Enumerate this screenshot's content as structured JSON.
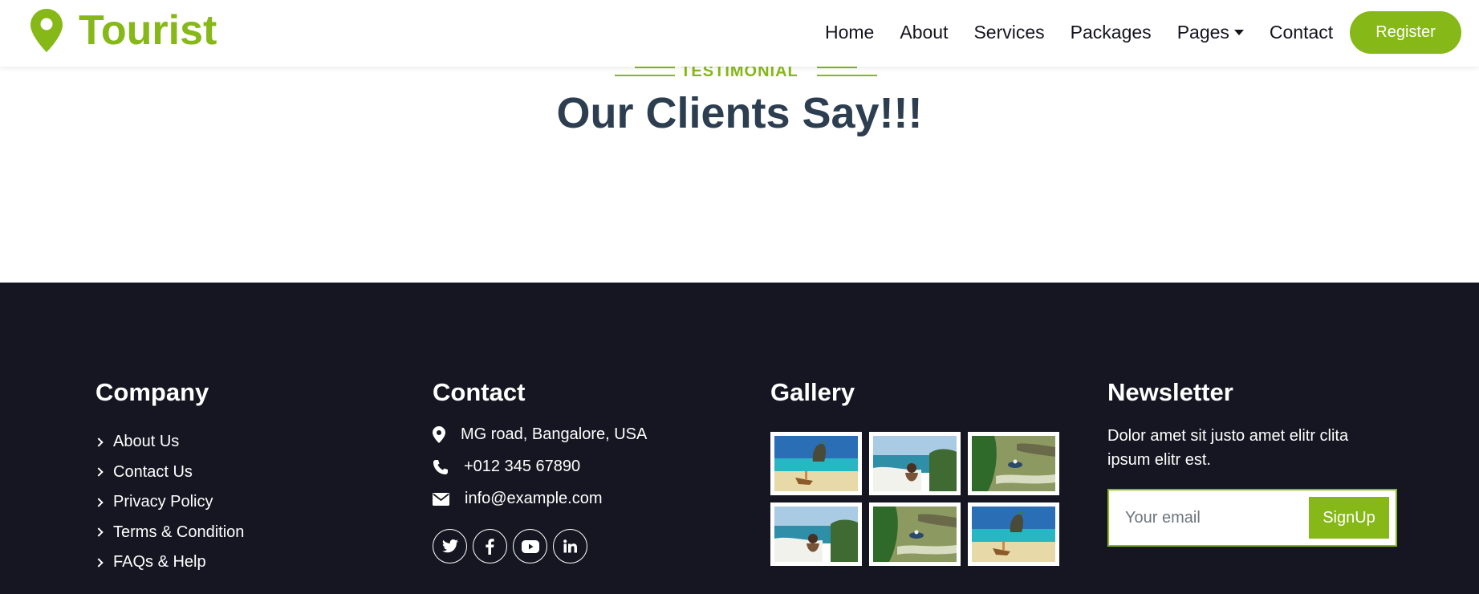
{
  "brand": {
    "name": "Tourist",
    "icon": "map-pin-icon",
    "color": "#86b817"
  },
  "nav": {
    "links": [
      "Home",
      "About",
      "Services",
      "Packages",
      "Pages",
      "Contact"
    ],
    "register_label": "Register"
  },
  "testimonial": {
    "eyebrow": "TESTIMONIAL",
    "title": "Our Clients Say!!!"
  },
  "footer": {
    "company": {
      "title": "Company",
      "links": [
        "About Us",
        "Contact Us",
        "Privacy Policy",
        "Terms & Condition",
        "FAQs & Help"
      ]
    },
    "contact": {
      "title": "Contact",
      "address": "MG road, Bangalore, USA",
      "phone": "+012 345 67890",
      "email": "info@example.com",
      "social": [
        "twitter-icon",
        "facebook-icon",
        "youtube-icon",
        "linkedin-icon"
      ]
    },
    "gallery": {
      "title": "Gallery",
      "images": [
        "beach-boat-image",
        "beach-woman-image",
        "river-boat-image",
        "beach-woman-image",
        "river-boat-image",
        "beach-boat-image"
      ]
    },
    "newsletter": {
      "title": "Newsletter",
      "text": "Dolor amet sit justo amet elitr clita ipsum elitr est.",
      "placeholder": "Your email",
      "button": "SignUp"
    }
  },
  "colors": {
    "accent": "#86b817",
    "dark": "#151621",
    "heading": "#2c3e50"
  }
}
